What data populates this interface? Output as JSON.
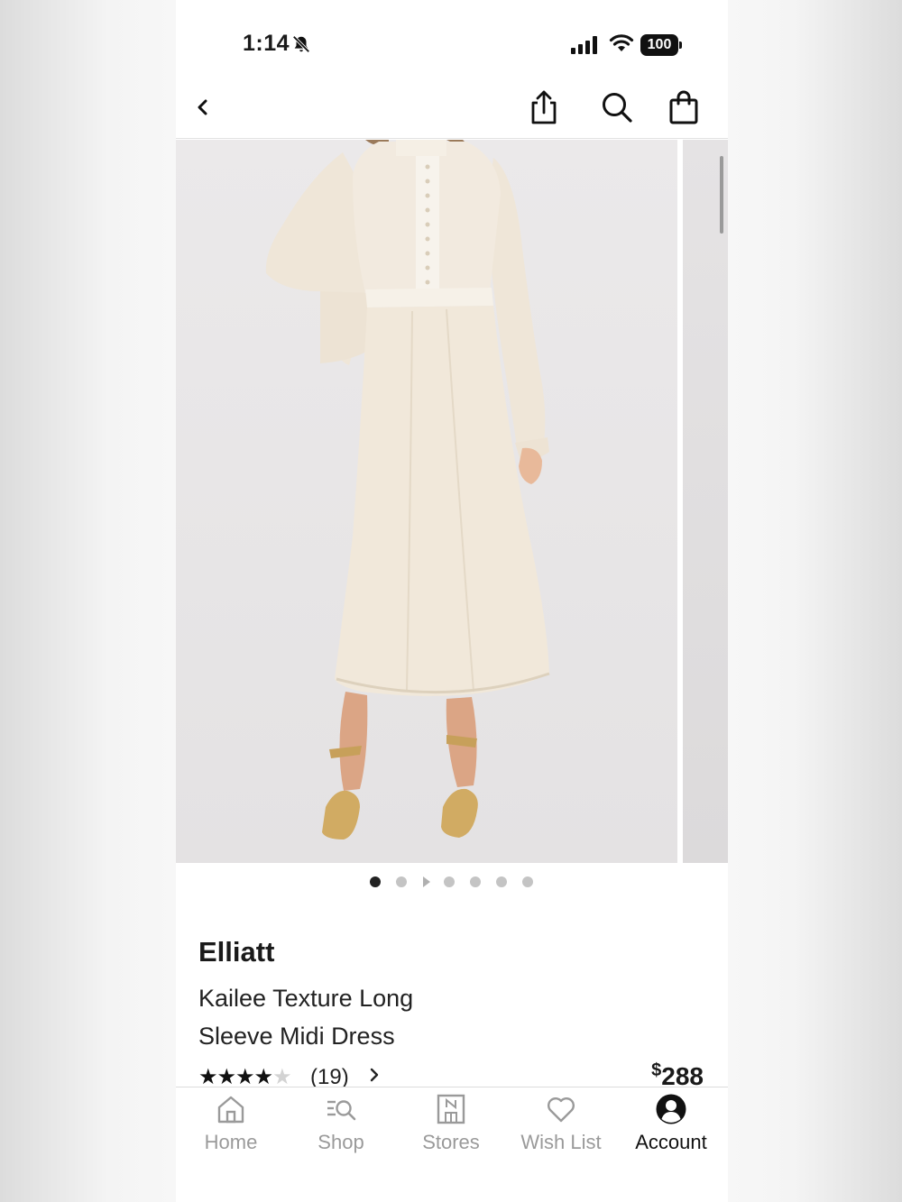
{
  "status_bar": {
    "time": "1:14",
    "battery": "100",
    "icons": [
      "bell-slash-icon",
      "signal-icon",
      "wifi-icon",
      "battery-icon"
    ]
  },
  "nav": {
    "icons": [
      "back-chevron-icon",
      "share-icon",
      "search-icon",
      "shopping-bag-icon"
    ]
  },
  "carousel": {
    "image_count": 7,
    "active_index": 0,
    "video_dot_index": 2
  },
  "product": {
    "brand": "Elliatt",
    "title": "Kailee Texture Long Sleeve Midi Dress",
    "rating": 4,
    "rating_max": 5,
    "review_count": "(19)",
    "price_currency": "$",
    "price_value": "288"
  },
  "tabs": [
    {
      "label": "Home",
      "icon": "home-icon",
      "active": false
    },
    {
      "label": "Shop",
      "icon": "shop-search-icon",
      "active": false
    },
    {
      "label": "Stores",
      "icon": "store-icon",
      "active": false
    },
    {
      "label": "Wish List",
      "icon": "heart-icon",
      "active": false
    },
    {
      "label": "Account",
      "icon": "account-icon",
      "active": true
    }
  ],
  "colors": {
    "text": "#1a1a1a",
    "inactive_tab": "#9a9a9a",
    "image_bg": "#e8e6e7",
    "dress": "#f0e8dc"
  }
}
